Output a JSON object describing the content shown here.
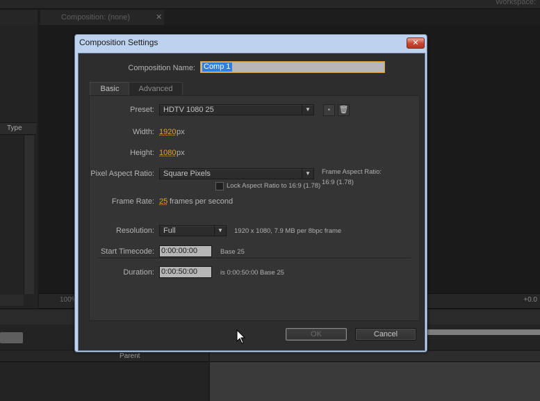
{
  "background": {
    "workspace_label": "Workspace:",
    "type_column": "Type",
    "composition_tab": "Composition: (none)",
    "zoom": "100%",
    "offset": "+0.0",
    "parent_column": "Parent"
  },
  "dialog": {
    "title": "Composition Settings",
    "close_glyph": "✕",
    "name_label": "Composition Name:",
    "name_value": "Comp 1",
    "tabs": [
      {
        "label": "Basic",
        "active": true
      },
      {
        "label": "Advanced",
        "active": false
      }
    ],
    "preset": {
      "label": "Preset:",
      "value": "HDTV 1080 25"
    },
    "width": {
      "label": "Width:",
      "value": "1920",
      "unit": "px"
    },
    "height": {
      "label": "Height:",
      "value": "1080",
      "unit": "px"
    },
    "lock_aspect": {
      "label": "Lock Aspect Ratio to 16:9 (1.78)",
      "checked": false
    },
    "pixel_aspect": {
      "label": "Pixel Aspect Ratio:",
      "value": "Square Pixels"
    },
    "frame_aspect": {
      "label": "Frame Aspect Ratio:",
      "value": "16:9 (1.78)"
    },
    "frame_rate": {
      "label": "Frame Rate:",
      "value": "25",
      "unit": "frames per second"
    },
    "resolution": {
      "label": "Resolution:",
      "value": "Full",
      "info": "1920 x 1080, 7.9 MB per 8bpc frame"
    },
    "start_timecode": {
      "label": "Start Timecode:",
      "value": "0:00:00:00",
      "info": "Base 25"
    },
    "duration": {
      "label": "Duration:",
      "value": "0:00:50:00",
      "info": "is 0:00:50:00  Base 25"
    },
    "ok_label": "OK",
    "cancel_label": "Cancel"
  },
  "colors": {
    "accent_orange": "#e0a139",
    "selection_blue": "#2f7fe0",
    "title_bar": "#bcd2ee",
    "close_red": "#c8452f"
  }
}
